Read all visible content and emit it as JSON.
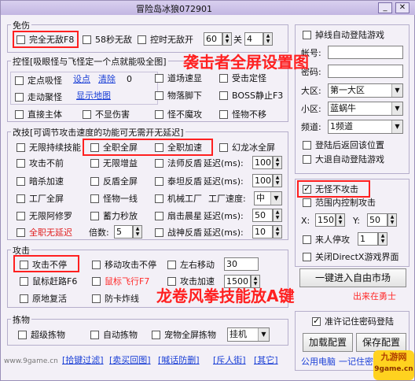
{
  "window": {
    "title": "冒险岛冰狼072901",
    "min": "_",
    "close": "✕"
  },
  "groups": {
    "mianshang": "免伤",
    "kongguai": "控怪[吸眼怪与飞怪定一个点就能吸全图]",
    "gaigong": "改技[可调节攻击速度的功能可无需开无延迟]",
    "gongji": "攻击",
    "jianwu": "拣物"
  },
  "mianshang": {
    "full_wudi": "完全无敌F8",
    "wudi58": "58秒无敌",
    "ctrl_wudi": "控时无敌开",
    "on_value": "60",
    "guan": "关",
    "off_value": "4"
  },
  "kongguai": {
    "dingdian": "定点吸怪",
    "set_point": "设点",
    "clear": "清除",
    "count": "0",
    "zoudong": "走动聚怪",
    "show_map": "显示地图",
    "zhijie": "直接主体",
    "bu_shanghai": "不显伤害",
    "daoju": "道场速显",
    "shoujidingguai": "受击定怪",
    "wuluo": "物落脚下",
    "boss": "BOSS静止F3",
    "buguai_shuiwei": "怪不魔攻",
    "guaiwu_buyi": "怪物不移"
  },
  "gaigong": {
    "wuxian_chixu": "无限持续技能",
    "quanzhi_quanping": "全职全屏",
    "quanzhi_jiasu": "全职加速",
    "huanlong": "幻龙冰全屏",
    "gongji_buer": "攻击不前",
    "wuxian_zengyi": "无限增益",
    "fashi_fanpan": "法师反盾",
    "yanchi1_lbl": "延迟(ms):",
    "yanchi1_val": "100",
    "anshaa": "暗杀加速",
    "fanpan_quan": "反盾全屏",
    "qinlang_fanpan": "泰坦反盾",
    "yanchi2_lbl": "延迟(ms):",
    "yanchi2_val": "100",
    "gongchang": "工厂全屏",
    "guaiwu_yixian": "怪物一线",
    "jixie": "机械工厂",
    "gongchang_sudu": "工厂速度:",
    "sudu_val": "中",
    "wuxian_a": "无限阿修罗",
    "xuli_miao": "蓄力秒放",
    "shandian": "扇击晨星",
    "yanchi3_lbl": "延迟(ms):",
    "yanchi3_val": "50",
    "quanzhi_yanchi": "全职无延迟",
    "beishu_lbl": "倍数:",
    "beishu_val": "5",
    "zhanshen": "战神反盾",
    "yanchi4_lbl": "延迟(ms):",
    "yanchi4_val": "10"
  },
  "gongji": {
    "gongji_buting": "攻击不停",
    "yidong": "移动攻击不停",
    "zuoyou": "左右移动",
    "zuoyou_val": "30",
    "shubiao": "鼠标赶路F6",
    "shubiao_fei": "鼠标飞行F7",
    "gongji_jiasu": "攻击加速",
    "jiasu_val": "1500",
    "yuandi": "原地复活",
    "fangka": "防卡炸线"
  },
  "jianwu": {
    "chaoji": "超级拣物",
    "zidong": "自动拣物",
    "chongwu": "宠物全屏拣物",
    "mode": "挂机"
  },
  "bottom_links": [
    "[拾键过滤]",
    "[卖买回图]",
    "[喊话防删]",
    "[斥人街]",
    "[其它]"
  ],
  "watermark": "www.9game.cn",
  "right": {
    "diaoxian": "掉线自动登陆游戏",
    "zhanghao": "帐号:",
    "mima": "密码:",
    "daqu_lbl": "大区:",
    "daqu_val": "第一大区",
    "xiaoqu_lbl": "小区:",
    "xiaoqu_val": "蓝蜗牛",
    "pindao_lbl": "频道:",
    "pindao_val": "1频道",
    "denglu_huiyuan": "登陆后返回该位置",
    "datui": "大退自动登陆游戏",
    "wuguai": "无怪不攻击",
    "fanwei": "范围内控制攻击",
    "x_lbl": "X:",
    "x_val": "150",
    "y_lbl": "Y:",
    "y_val": "50",
    "lairen": "来人停攻",
    "lairen_val": "1",
    "guanbi_dx": "关闭DirectX游戏界面",
    "jinru": "一键进入自由市场",
    "chulai": "出来在勇士",
    "jizhu": "准许记住密码登陆",
    "jiazai": "加载配置",
    "baocun": "保存配置",
    "gongyong": "公用电脑",
    "mima_tip": "一记住密码"
  },
  "overlays": {
    "top": "袭击者全屏设置图",
    "bottom": "龙卷风拳技能放A键"
  },
  "badge": {
    "line1": "九游网",
    "line2": "9game.cn"
  }
}
